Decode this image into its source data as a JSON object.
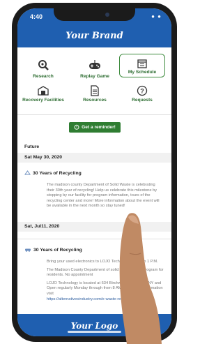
{
  "status": {
    "time": "4:40",
    "icons": "● ●"
  },
  "header": {
    "brand": "Your Brand"
  },
  "nav": {
    "research": "Research",
    "replay_game": "Replay Game",
    "my_schedule": "My Schedule",
    "recovery_facilities": "Recovery Facilities",
    "resources": "Resources",
    "requests": "Requests"
  },
  "reminder": {
    "label": "Get a reminder!"
  },
  "schedule": {
    "section": "Future",
    "date1": "Sat May 30, 2020",
    "event1": {
      "title": "30 Years of Recycling",
      "body": "The madison county Department of Solid Waste is celebrating their 30th year of recycling! Help us celebrate this milestone by stopping by our facility for program information, tours of the recycling center and more! More information about the event will be available in the next month so stay tuned!"
    },
    "date2": "Sat, Jul11, 2020",
    "event2": {
      "title": "30 Years of Recycling",
      "p1": "Bring your used electronics to LOJO Technology 9 Am to 1 P.M.",
      "p2": "The Madison County Department of solid waste FREE program for residents. No appointment",
      "p3": "LOJO Technology is located at 634 Birchwood Dr Oneida NY and Open regularly Monday through from 8 AM to 3 PM for information visit",
      "link": "https://alternativesindustry.com/e-waste-recycling"
    }
  },
  "footer": {
    "logo": "Your Logo"
  },
  "colors": {
    "brand_blue": "#1f5fb0",
    "accent_green": "#2f7d32"
  }
}
